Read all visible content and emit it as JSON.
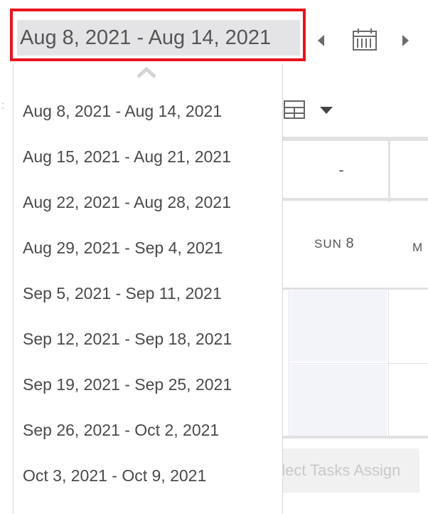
{
  "date_range": {
    "selected": "Aug 8, 2021 - Aug 14, 2021",
    "options": [
      "Aug 8, 2021 - Aug 14, 2021",
      "Aug 15, 2021 - Aug 21, 2021",
      "Aug 22, 2021 - Aug 28, 2021",
      "Aug 29, 2021 - Sep 4, 2021",
      "Sep 5, 2021 - Sep 11, 2021",
      "Sep 12, 2021 - Sep 18, 2021",
      "Sep 19, 2021 - Sep 25, 2021",
      "Sep 26, 2021 - Oct 2, 2021",
      "Oct 3, 2021 - Oct 9, 2021"
    ]
  },
  "timesheet": {
    "header_dash": "-",
    "day_name": "SUN",
    "day_number": "8",
    "next_day_initial": "M",
    "footer_text": "elect Tasks Assign"
  },
  "icons": {
    "prev": "chevron-left-icon",
    "calendar": "calendar-icon",
    "next": "chevron-right-icon",
    "grid": "grid-view-icon",
    "dropdown_caret": "caret-down-icon"
  },
  "colors": {
    "highlight": "#e8141c",
    "selector_bg": "#e4e4e6",
    "grid_cell": "#f3f4fa",
    "gray_bar": "#e1e1e1"
  }
}
